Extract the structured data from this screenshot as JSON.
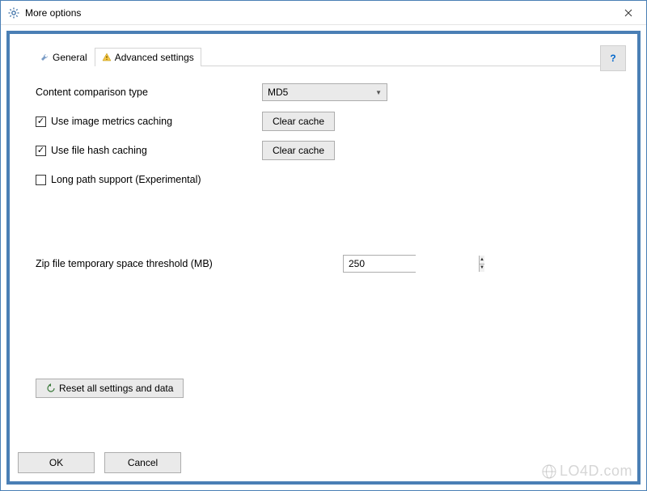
{
  "titlebar": {
    "title": "More options"
  },
  "tabs": {
    "general": "General",
    "advanced": "Advanced settings"
  },
  "panel": {
    "comparison_label": "Content comparison type",
    "comparison_value": "MD5",
    "image_cache_label": "Use image metrics caching",
    "image_cache_checked": true,
    "file_cache_label": "Use file hash caching",
    "file_cache_checked": true,
    "long_path_label": "Long path support (Experimental)",
    "long_path_checked": false,
    "clear_cache_label": "Clear cache",
    "zip_threshold_label": "Zip file temporary space threshold (MB)",
    "zip_threshold_value": "250",
    "reset_label": "Reset all settings and data"
  },
  "buttons": {
    "ok": "OK",
    "cancel": "Cancel",
    "help": "?"
  },
  "watermark": "LO4D.com"
}
